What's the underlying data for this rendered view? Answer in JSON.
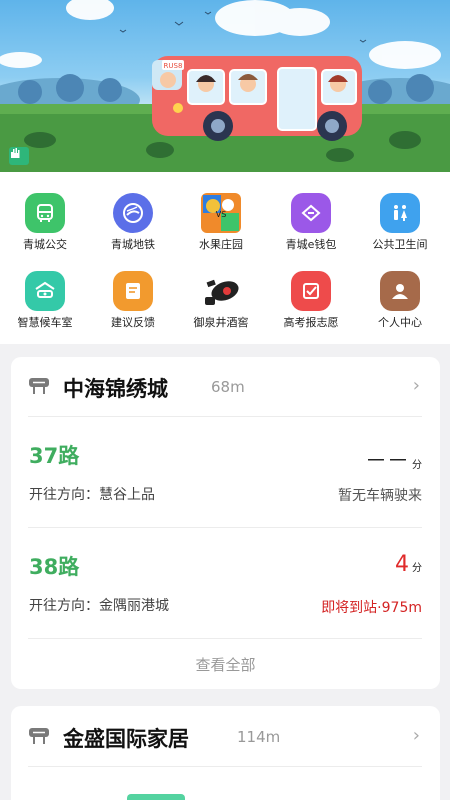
{
  "banner": {
    "bus_plate": "RUS8"
  },
  "grid": {
    "items": [
      {
        "label": "青城公交",
        "icon": "bus-icon",
        "color": "#3ec46a"
      },
      {
        "label": "青城地铁",
        "icon": "metro-icon",
        "color": "#5b6fe8"
      },
      {
        "label": "水果庄园",
        "icon": "fruit-icon",
        "color": "#f08a2b"
      },
      {
        "label": "青城e钱包",
        "icon": "wallet-icon",
        "color": "#9b58e8"
      },
      {
        "label": "公共卫生间",
        "icon": "toilet-icon",
        "color": "#3fa2ee"
      },
      {
        "label": "智慧候车室",
        "icon": "waiting-room-icon",
        "color": "#34c9a8"
      },
      {
        "label": "建议反馈",
        "icon": "feedback-icon",
        "color": "#f29a2e"
      },
      {
        "label": "御泉井酒窖",
        "icon": "wine-icon",
        "color": "#222222"
      },
      {
        "label": "高考报志愿",
        "icon": "exam-icon",
        "color": "#ee4b4b"
      },
      {
        "label": "个人中心",
        "icon": "user-icon",
        "color": "#a66a4a"
      }
    ]
  },
  "stations": [
    {
      "name": "中海锦绣城",
      "distance": "68m",
      "routes": [
        {
          "route": "37路",
          "direction_label": "开往方向：",
          "direction": "慧谷上品",
          "eta": "－－",
          "eta_unit": "分",
          "status": "暂无车辆驶来"
        },
        {
          "route": "38路",
          "direction_label": "开往方向：",
          "direction": "金隅丽港城",
          "eta": "4",
          "eta_unit": "分",
          "status": "即将到站·975m"
        }
      ],
      "view_all": "查看全部"
    },
    {
      "name": "金盛国际家居",
      "distance": "114m"
    }
  ],
  "colors": {
    "route_green": "#3fad5f",
    "alert_red": "#e02a2a"
  }
}
